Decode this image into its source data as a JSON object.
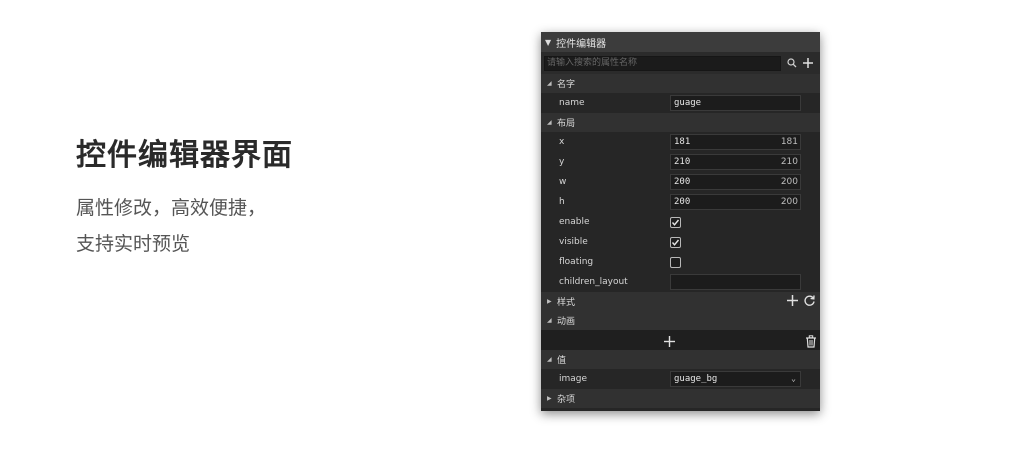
{
  "intro": {
    "title": "控件编辑器界面",
    "line1": "属性修改，高效便捷，",
    "line2": "支持实时预览"
  },
  "panel": {
    "title": "控件编辑器",
    "search_placeholder": "请输入搜索的属性名称",
    "sections": {
      "name": {
        "label": "名字",
        "fields": {
          "name_label": "name",
          "name_value": "guage"
        }
      },
      "layout": {
        "label": "布局",
        "fields": {
          "x_label": "x",
          "x_value": "181",
          "x_right": "181",
          "y_label": "y",
          "y_value": "210",
          "y_right": "210",
          "w_label": "w",
          "w_value": "200",
          "w_right": "200",
          "h_label": "h",
          "h_value": "200",
          "h_right": "200",
          "enable_label": "enable",
          "enable_checked": true,
          "visible_label": "visible",
          "visible_checked": true,
          "floating_label": "floating",
          "floating_checked": false,
          "children_layout_label": "children_layout",
          "children_layout_value": ""
        }
      },
      "style": {
        "label": "样式"
      },
      "animation": {
        "label": "动画"
      },
      "value": {
        "label": "值",
        "fields": {
          "image_label": "image",
          "image_value": "guage_bg"
        }
      },
      "misc": {
        "label": "杂项"
      }
    }
  },
  "colors": {
    "panel_bg": "#262626",
    "section_bg": "#313131",
    "title_bg": "#3c3c3c",
    "field_bg": "#1c1c1c",
    "text": "#d4d4d4"
  }
}
